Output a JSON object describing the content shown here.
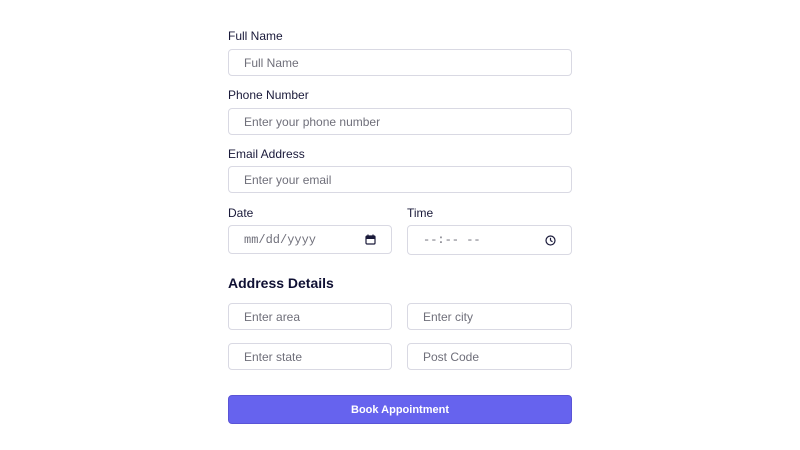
{
  "form": {
    "full_name": {
      "label": "Full Name",
      "placeholder": "Full Name"
    },
    "phone": {
      "label": "Phone Number",
      "placeholder": "Enter your phone number"
    },
    "email": {
      "label": "Email Address",
      "placeholder": "Enter your email"
    },
    "date": {
      "label": "Date",
      "placeholder": "mm/dd/yyyy",
      "icon": "calendar-icon"
    },
    "time": {
      "label": "Time",
      "placeholder": "--:-- --",
      "icon": "clock-icon"
    }
  },
  "address": {
    "title": "Address Details",
    "area": {
      "placeholder": "Enter area"
    },
    "city": {
      "placeholder": "Enter city"
    },
    "state": {
      "placeholder": "Enter state"
    },
    "post_code": {
      "placeholder": "Post Code"
    }
  },
  "submit": {
    "label": "Book Appointment"
  },
  "colors": {
    "accent": "#6663ee",
    "text": "#1a1a3a",
    "border": "#d9d9e3"
  }
}
